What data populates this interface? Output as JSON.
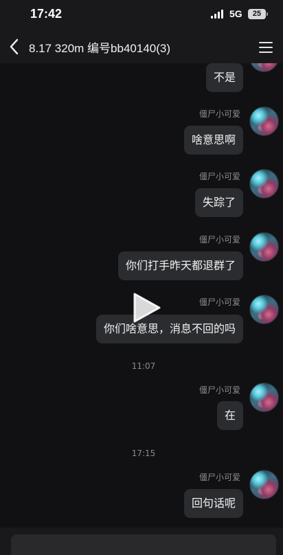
{
  "status_bar": {
    "time": "17:42",
    "network": "5G",
    "battery": "25"
  },
  "header": {
    "title": "8.17 320m 编号bb40140(3)",
    "back_icon": "chevron-left-icon",
    "menu_icon": "hamburger-menu-icon"
  },
  "messages": [
    {
      "sender": "",
      "text": "不是"
    },
    {
      "sender": "僵尸小可爱",
      "text": "啥意思啊"
    },
    {
      "sender": "僵尸小可爱",
      "text": "失踪了"
    },
    {
      "sender": "僵尸小可爱",
      "text": "你们打手昨天都退群了"
    },
    {
      "sender": "僵尸小可爱",
      "text": "你们啥意思，消息不回的吗"
    },
    {
      "sender": "僵尸小可爱",
      "text": "在"
    },
    {
      "sender": "僵尸小可爱",
      "text": "回句话呢"
    }
  ],
  "timestamps": [
    "11:07",
    "17:15"
  ],
  "overlay": {
    "play_icon": "play-icon"
  }
}
